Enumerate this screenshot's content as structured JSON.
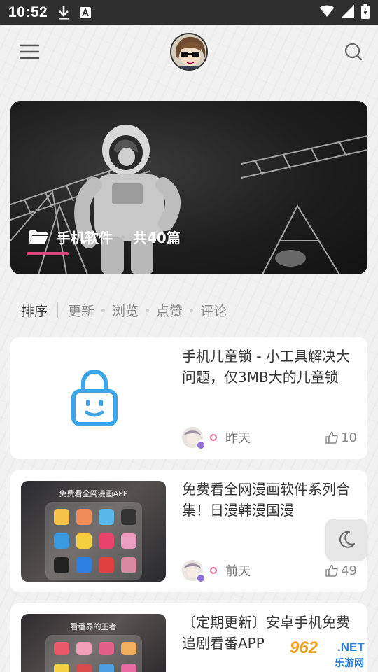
{
  "status_bar": {
    "time": "10:52"
  },
  "banner": {
    "category": "手机软件",
    "count": "共40篇"
  },
  "sort_bar": {
    "title": "排序",
    "options": [
      "更新",
      "浏览",
      "点赞",
      "评论"
    ]
  },
  "cards": [
    {
      "title": "手机儿童锁 - 小工具解决大问题，仅3MB大的儿童锁",
      "time": "昨天",
      "likes": "10"
    },
    {
      "title": "免费看全网漫画软件系列合集！日漫韩漫国漫",
      "time": "前天",
      "likes": "49",
      "thumb_heading": "免费看全网漫画APP"
    },
    {
      "title": "〔定期更新〕安卓手机免费追剧看番APP",
      "thumb_heading": "看番界的王者"
    }
  ],
  "watermark": {
    "number": "962",
    "domain": ".NET",
    "name": "乐游网"
  },
  "colors": {
    "accent": "#e0457b",
    "lock_icon": "#3aa5e8",
    "status_bar": "#2f2f2f"
  }
}
